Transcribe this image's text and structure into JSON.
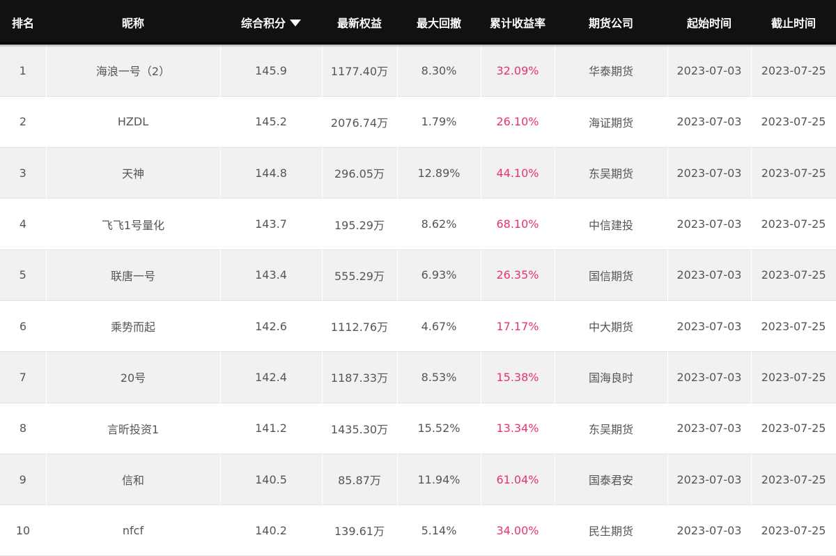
{
  "header": {
    "rank": "排名",
    "nickname": "昵称",
    "score": "综合积分",
    "equity": "最新权益",
    "drawdown": "最大回撤",
    "return": "累计收益率",
    "company": "期货公司",
    "start": "起始时间",
    "end": "截止时间",
    "sort_icon": "triangle-down-icon"
  },
  "colors": {
    "header_bg": "#111111",
    "return_text": "#e8336d",
    "row_alt_bg": "#f1f1f1"
  },
  "rows": [
    {
      "rank": "1",
      "nickname": "海浪一号（2）",
      "score": "145.9",
      "equity": "1177.40万",
      "drawdown": "8.30%",
      "return": "32.09%",
      "company": "华泰期货",
      "start": "2023-07-03",
      "end": "2023-07-25"
    },
    {
      "rank": "2",
      "nickname": "HZDL",
      "score": "145.2",
      "equity": "2076.74万",
      "drawdown": "1.79%",
      "return": "26.10%",
      "company": "海证期货",
      "start": "2023-07-03",
      "end": "2023-07-25"
    },
    {
      "rank": "3",
      "nickname": "天神",
      "score": "144.8",
      "equity": "296.05万",
      "drawdown": "12.89%",
      "return": "44.10%",
      "company": "东吴期货",
      "start": "2023-07-03",
      "end": "2023-07-25"
    },
    {
      "rank": "4",
      "nickname": "飞飞1号量化",
      "score": "143.7",
      "equity": "195.29万",
      "drawdown": "8.62%",
      "return": "68.10%",
      "company": "中信建投",
      "start": "2023-07-03",
      "end": "2023-07-25"
    },
    {
      "rank": "5",
      "nickname": "联唐一号",
      "score": "143.4",
      "equity": "555.29万",
      "drawdown": "6.93%",
      "return": "26.35%",
      "company": "国信期货",
      "start": "2023-07-03",
      "end": "2023-07-25"
    },
    {
      "rank": "6",
      "nickname": "乘势而起",
      "score": "142.6",
      "equity": "1112.76万",
      "drawdown": "4.67%",
      "return": "17.17%",
      "company": "中大期货",
      "start": "2023-07-03",
      "end": "2023-07-25"
    },
    {
      "rank": "7",
      "nickname": "20号",
      "score": "142.4",
      "equity": "1187.33万",
      "drawdown": "8.53%",
      "return": "15.38%",
      "company": "国海良时",
      "start": "2023-07-03",
      "end": "2023-07-25"
    },
    {
      "rank": "8",
      "nickname": "言昕投资1",
      "score": "141.2",
      "equity": "1435.30万",
      "drawdown": "15.52%",
      "return": "13.34%",
      "company": "东吴期货",
      "start": "2023-07-03",
      "end": "2023-07-25"
    },
    {
      "rank": "9",
      "nickname": "信和",
      "score": "140.5",
      "equity": "85.87万",
      "drawdown": "11.94%",
      "return": "61.04%",
      "company": "国泰君安",
      "start": "2023-07-03",
      "end": "2023-07-25"
    },
    {
      "rank": "10",
      "nickname": "nfcf",
      "score": "140.2",
      "equity": "139.61万",
      "drawdown": "5.14%",
      "return": "34.00%",
      "company": "民生期货",
      "start": "2023-07-03",
      "end": "2023-07-25"
    }
  ]
}
